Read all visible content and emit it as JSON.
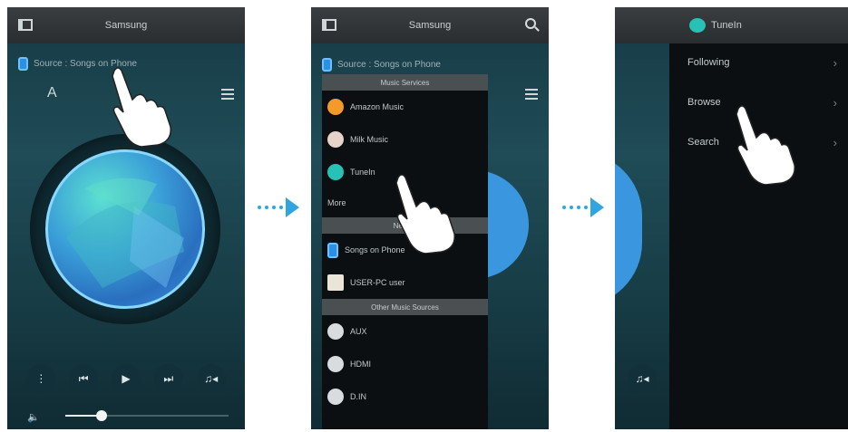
{
  "screen1": {
    "app_title": "Samsung",
    "source_label": "Source : Songs on Phone",
    "alpha_label": "A",
    "controls": {
      "prev": "⏮",
      "play": "▶",
      "next": "⏭",
      "queue": "♫◂",
      "more": "⋮",
      "volume": "🔈"
    },
    "volume_level": 0.22
  },
  "screen2": {
    "app_title": "Samsung",
    "source_label": "Source : Songs on Phone",
    "sections": {
      "music_services": "Music Services",
      "nearby": "Nearby",
      "other_sources": "Other Music Sources"
    },
    "music_services": [
      {
        "label": "Amazon Music",
        "color": "#f39a2b"
      },
      {
        "label": "Milk Music",
        "color": "#e8d3c9"
      },
      {
        "label": "TuneIn",
        "color": "#27c2b5"
      }
    ],
    "more_label": "More",
    "nearby": [
      {
        "label": "Songs on Phone",
        "icon": "phone-icon"
      },
      {
        "label": "USER-PC user",
        "icon": "pc-icon"
      }
    ],
    "other_sources": [
      {
        "label": "AUX",
        "icon": "cable-icon"
      },
      {
        "label": "HDMI",
        "icon": "cable-icon"
      },
      {
        "label": "D.IN",
        "icon": "cable-icon"
      }
    ]
  },
  "screen3": {
    "app_title": "TuneIn",
    "items": [
      {
        "label": "Following"
      },
      {
        "label": "Browse"
      },
      {
        "label": "Search"
      }
    ]
  },
  "colors": {
    "accent": "#2fa6df",
    "topbar": "#34383b",
    "menu": "#0b0f11"
  }
}
